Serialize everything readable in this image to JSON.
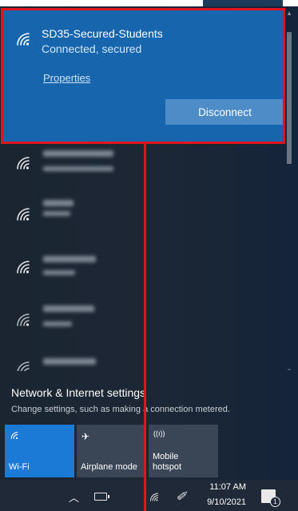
{
  "connected": {
    "ssid": "SD35-Secured-Students",
    "status": "Connected, secured",
    "properties_label": "Properties",
    "disconnect_label": "Disconnect",
    "icon": "wifi-icon"
  },
  "other_networks": [
    {
      "icon": "wifi-icon"
    },
    {
      "icon": "wifi-icon"
    },
    {
      "icon": "wifi-icon"
    },
    {
      "icon": "wifi-icon"
    },
    {
      "icon": "wifi-icon"
    }
  ],
  "settings": {
    "title": "Network & Internet settings",
    "subtitle": "Change settings, such as making a connection metered."
  },
  "quick_actions": {
    "wifi_label": "Wi-Fi",
    "airplane_label": "Airplane mode",
    "hotspot_label_1": "Mobile",
    "hotspot_label_2": "hotspot"
  },
  "taskbar": {
    "time": "11:07 AM",
    "date": "9/10/2021",
    "notification_count": "1"
  },
  "colors": {
    "accent": "#1665ad",
    "wifi_tile": "#1a7ad6",
    "highlight": "#e0141c"
  }
}
